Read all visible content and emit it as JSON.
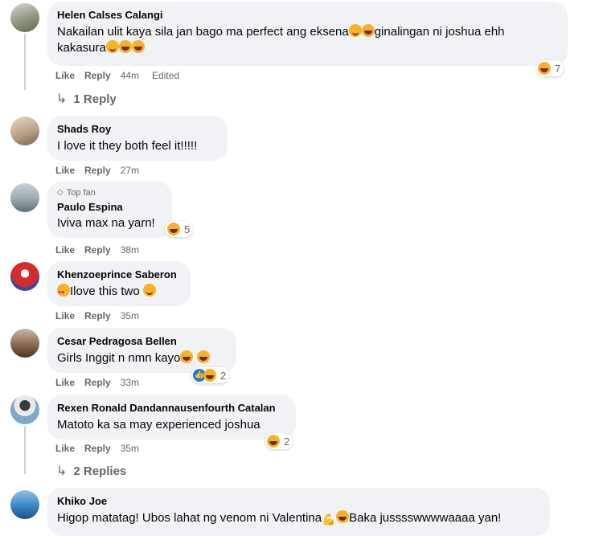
{
  "comments": [
    {
      "name": "Helen Calses Calangi",
      "text": "Nakailan ulit kaya sila jan bago ma perfect ang eksena",
      "text2": "ginalingan ni joshua ehh",
      "text3": "kakasura",
      "like": "Like",
      "reply": "Reply",
      "time": "44m",
      "edited": "Edited",
      "reaction_count": "7",
      "replies_label": "1 Reply"
    },
    {
      "name": "Shads Roy",
      "text": "I love it they both feel it!!!!!",
      "like": "Like",
      "reply": "Reply",
      "time": "27m"
    },
    {
      "badge": "Top fan",
      "name": "Paulo Espina",
      "text": "Iviva max na yarn!",
      "like": "Like",
      "reply": "Reply",
      "time": "38m",
      "reaction_count": "5"
    },
    {
      "name": "Khenzoeprince Saberon",
      "text": "Ilove this two",
      "like": "Like",
      "reply": "Reply",
      "time": "35m"
    },
    {
      "name": "Cesar Pedragosa Bellen",
      "text": "Girls Inggit n nmn kayo",
      "like": "Like",
      "reply": "Reply",
      "time": "33m",
      "reaction_count": "2"
    },
    {
      "name": "Rexen Ronald Dandannausenfourth Catalan",
      "text": "Matoto ka sa may experienced joshua",
      "like": "Like",
      "reply": "Reply",
      "time": "35m",
      "reaction_count": "2",
      "replies_label": "2 Replies"
    },
    {
      "name": "Khiko Joe",
      "text": "Higop matatag! Ubos lahat ng venom ni Valentina",
      "text2": "Baka jusssswwwwaaaa yan!"
    }
  ],
  "colors": {
    "bubble": "#f0f2f5",
    "meta": "#65676b",
    "name": "#050505",
    "haha": "#f7b125",
    "like_blue": "#1877f2"
  },
  "icons": [
    "haha-emoji",
    "love-emoji",
    "smile-emoji",
    "like-emoji",
    "muscle-emoji",
    "reply-arrow-icon",
    "top-fan-icon"
  ]
}
